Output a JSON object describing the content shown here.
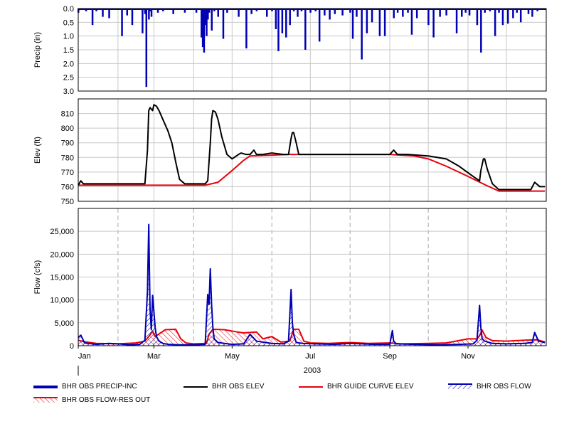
{
  "chart_data": [
    {
      "type": "bar",
      "ylabel": "Precip (in)",
      "ylim": [
        3.0,
        0.0
      ],
      "inverted": true,
      "yticks": [
        "0.0",
        "0.5",
        "1.0",
        "1.5",
        "2.0",
        "2.5",
        "3.0"
      ],
      "grid": true,
      "series": [
        {
          "name": "BHR OBS PRECIP-INC",
          "color": "#0000b4",
          "x": [
            "2003-01-01",
            "2003-01-03",
            "2003-01-07",
            "2003-01-12",
            "2003-01-15",
            "2003-01-20",
            "2003-01-25",
            "2003-01-31",
            "2003-02-04",
            "2003-02-08",
            "2003-02-12",
            "2003-02-16",
            "2003-02-20",
            "2003-02-22",
            "2003-02-23",
            "2003-02-25",
            "2003-02-26",
            "2003-02-27",
            "2003-03-01",
            "2003-03-04",
            "2003-03-08",
            "2003-03-12",
            "2003-03-16",
            "2003-03-20",
            "2003-03-25",
            "2003-03-30",
            "2003-04-03",
            "2003-04-07",
            "2003-04-08",
            "2003-04-09",
            "2003-04-10",
            "2003-04-11",
            "2003-04-12",
            "2003-04-13",
            "2003-04-15",
            "2003-04-17",
            "2003-04-20",
            "2003-04-24",
            "2003-04-27",
            "2003-05-02",
            "2003-05-06",
            "2003-05-09",
            "2003-05-12",
            "2003-05-16",
            "2003-05-20",
            "2003-05-25",
            "2003-05-28",
            "2003-06-01",
            "2003-06-04",
            "2003-06-06",
            "2003-06-09",
            "2003-06-12",
            "2003-06-15",
            "2003-06-18",
            "2003-06-21",
            "2003-06-24",
            "2003-06-27",
            "2003-07-01",
            "2003-07-05",
            "2003-07-08",
            "2003-07-10",
            "2003-07-12",
            "2003-07-16",
            "2003-07-20",
            "2003-07-22",
            "2003-07-26",
            "2003-07-29",
            "2003-08-01",
            "2003-08-03",
            "2003-08-06",
            "2003-08-10",
            "2003-08-14",
            "2003-08-18",
            "2003-08-20",
            "2003-08-24",
            "2003-08-28",
            "2003-09-01",
            "2003-09-04",
            "2003-09-07",
            "2003-09-11",
            "2003-09-15",
            "2003-09-18",
            "2003-09-22",
            "2003-09-27",
            "2003-10-01",
            "2003-10-05",
            "2003-10-10",
            "2003-10-15",
            "2003-10-19",
            "2003-10-23",
            "2003-10-27",
            "2003-10-30",
            "2003-11-02",
            "2003-11-05",
            "2003-11-08",
            "2003-11-11",
            "2003-11-14",
            "2003-11-18",
            "2003-11-22",
            "2003-11-25",
            "2003-11-28",
            "2003-12-02",
            "2003-12-06",
            "2003-12-09",
            "2003-12-12",
            "2003-12-15",
            "2003-12-18",
            "2003-12-21",
            "2003-12-25",
            "2003-12-29"
          ],
          "values": [
            0.15,
            0.05,
            0.1,
            0.6,
            0.1,
            0.3,
            0.35,
            0.05,
            1.0,
            0.25,
            0.6,
            0.05,
            0.9,
            0.2,
            2.85,
            0.4,
            0.1,
            0.3,
            0.05,
            0.15,
            0.1,
            0.05,
            0.2,
            0.05,
            0.15,
            0.05,
            0.15,
            1.05,
            1.4,
            1.6,
            0.6,
            1.0,
            0.4,
            0.15,
            0.8,
            0.1,
            0.3,
            1.1,
            0.15,
            0.05,
            0.3,
            0.05,
            1.45,
            0.2,
            0.1,
            0.05,
            0.3,
            0.1,
            0.75,
            1.55,
            0.9,
            1.05,
            0.6,
            0.1,
            0.3,
            0.1,
            1.5,
            0.15,
            0.1,
            1.2,
            0.05,
            0.25,
            0.4,
            0.2,
            0.05,
            0.25,
            0.05,
            0.15,
            1.1,
            0.3,
            1.85,
            0.9,
            0.5,
            0.05,
            1.0,
            1.0,
            0.05,
            0.35,
            0.15,
            0.3,
            0.15,
            0.95,
            0.35,
            0.05,
            0.6,
            1.05,
            0.3,
            0.25,
            0.05,
            0.9,
            0.3,
            0.15,
            0.25,
            0.05,
            0.6,
            1.6,
            0.15,
            0.1,
            1.0,
            0.15,
            0.6,
            0.55,
            0.35,
            0.15,
            0.5,
            0.05,
            0.2,
            0.3,
            0.1,
            0.05
          ]
        }
      ]
    },
    {
      "type": "line",
      "ylabel": "Elev (ft)",
      "ylim": [
        750,
        820
      ],
      "yticks": [
        "750",
        "760",
        "770",
        "780",
        "790",
        "800",
        "810"
      ],
      "grid": true,
      "series": [
        {
          "name": "BHR OBS ELEV",
          "color": "#000000",
          "x": [
            "2003-01-01",
            "2003-01-03",
            "2003-01-05",
            "2003-01-10",
            "2003-01-20",
            "2003-01-31",
            "2003-02-10",
            "2003-02-15",
            "2003-02-20",
            "2003-02-22",
            "2003-02-24",
            "2003-02-25",
            "2003-02-26",
            "2003-02-28",
            "2003-03-01",
            "2003-03-03",
            "2003-03-05",
            "2003-03-08",
            "2003-03-12",
            "2003-03-15",
            "2003-03-18",
            "2003-03-21",
            "2003-03-25",
            "2003-03-30",
            "2003-04-05",
            "2003-04-08",
            "2003-04-10",
            "2003-04-12",
            "2003-04-14",
            "2003-04-15",
            "2003-04-16",
            "2003-04-18",
            "2003-04-20",
            "2003-04-23",
            "2003-04-27",
            "2003-05-01",
            "2003-05-06",
            "2003-05-08",
            "2003-05-12",
            "2003-05-15",
            "2003-05-18",
            "2003-05-20",
            "2003-05-25",
            "2003-06-01",
            "2003-06-10",
            "2003-06-14",
            "2003-06-16",
            "2003-06-17",
            "2003-06-18",
            "2003-06-20",
            "2003-06-22",
            "2003-06-25",
            "2003-07-01",
            "2003-07-15",
            "2003-08-01",
            "2003-08-15",
            "2003-09-01",
            "2003-09-04",
            "2003-09-05",
            "2003-09-07",
            "2003-09-15",
            "2003-10-01",
            "2003-10-15",
            "2003-10-25",
            "2003-11-05",
            "2003-11-10",
            "2003-11-11",
            "2003-11-13",
            "2003-11-14",
            "2003-11-16",
            "2003-11-20",
            "2003-11-25",
            "2003-12-01",
            "2003-12-05",
            "2003-12-10",
            "2003-12-20",
            "2003-12-23",
            "2003-12-27",
            "2003-12-31"
          ],
          "values": [
            761,
            764,
            762,
            762,
            762,
            762,
            762,
            762,
            762,
            762,
            785,
            812,
            814,
            812,
            816,
            815,
            812,
            806,
            798,
            790,
            777,
            765,
            762,
            762,
            762,
            762,
            762,
            764,
            790,
            806,
            812,
            811,
            806,
            794,
            782,
            779,
            782,
            783,
            782,
            782,
            785,
            782,
            782,
            783,
            782,
            782,
            793,
            797,
            797,
            790,
            782,
            782,
            782,
            782,
            782,
            782,
            782,
            785,
            784,
            782,
            782,
            781,
            779,
            774,
            767,
            764,
            771,
            779,
            779,
            772,
            762,
            758,
            758,
            758,
            758,
            758,
            763,
            760,
            760
          ]
        },
        {
          "name": "BHR GUIDE CURVE ELEV",
          "color": "#e8000b",
          "x": [
            "2003-01-01",
            "2003-04-10",
            "2003-04-20",
            "2003-05-01",
            "2003-05-10",
            "2003-05-15",
            "2003-06-15",
            "2003-09-01",
            "2003-09-20",
            "2003-10-01",
            "2003-10-15",
            "2003-11-01",
            "2003-11-15",
            "2003-11-25",
            "2003-12-31"
          ],
          "values": [
            761,
            761,
            763,
            771,
            778,
            781,
            782,
            782,
            781,
            779,
            774,
            767,
            761,
            757,
            757
          ]
        }
      ]
    },
    {
      "type": "area",
      "ylabel": "Flow (cfs)",
      "xlabel": "2003",
      "ylim": [
        0,
        30000
      ],
      "yticks": [
        "0",
        "5,000",
        "10,000",
        "15,000",
        "20,000",
        "25,000"
      ],
      "xticks": [
        "Jan",
        "Mar",
        "May",
        "Jul",
        "Sep",
        "Nov"
      ],
      "grid": true,
      "series": [
        {
          "name": "BHR OBS FLOW",
          "color": "#0000b4",
          "x": [
            "2003-01-01",
            "2003-01-03",
            "2003-01-06",
            "2003-01-15",
            "2003-01-25",
            "2003-02-01",
            "2003-02-10",
            "2003-02-18",
            "2003-02-22",
            "2003-02-24",
            "2003-02-25",
            "2003-02-26",
            "2003-02-27",
            "2003-02-28",
            "2003-03-02",
            "2003-03-03",
            "2003-03-05",
            "2003-03-08",
            "2003-03-12",
            "2003-03-20",
            "2003-04-01",
            "2003-04-10",
            "2003-04-12",
            "2003-04-13",
            "2003-04-14",
            "2003-04-15",
            "2003-04-16",
            "2003-04-17",
            "2003-04-20",
            "2003-04-25",
            "2003-05-01",
            "2003-05-10",
            "2003-05-15",
            "2003-05-20",
            "2003-06-01",
            "2003-06-10",
            "2003-06-14",
            "2003-06-16",
            "2003-06-17",
            "2003-06-18",
            "2003-06-20",
            "2003-06-25",
            "2003-07-05",
            "2003-07-20",
            "2003-08-01",
            "2003-08-20",
            "2003-09-01",
            "2003-09-03",
            "2003-09-04",
            "2003-09-06",
            "2003-09-20",
            "2003-10-10",
            "2003-10-25",
            "2003-11-05",
            "2003-11-08",
            "2003-11-10",
            "2003-11-11",
            "2003-11-12",
            "2003-11-14",
            "2003-11-20",
            "2003-12-01",
            "2003-12-15",
            "2003-12-21",
            "2003-12-23",
            "2003-12-26",
            "2003-12-31"
          ],
          "values": [
            1800,
            2300,
            600,
            300,
            500,
            400,
            200,
            300,
            1200,
            12000,
            26500,
            8000,
            3500,
            11000,
            4000,
            2000,
            1000,
            500,
            300,
            200,
            200,
            300,
            11200,
            9000,
            16800,
            9000,
            4000,
            1500,
            700,
            500,
            300,
            400,
            2500,
            1000,
            500,
            400,
            1000,
            12300,
            5000,
            2500,
            700,
            500,
            400,
            300,
            500,
            300,
            300,
            3300,
            1000,
            400,
            300,
            200,
            300,
            400,
            1200,
            8800,
            4000,
            1500,
            1000,
            500,
            400,
            500,
            700,
            2900,
            1000,
            700
          ]
        },
        {
          "name": "BHR OBS FLOW-RES OUT",
          "color": "#e8000b",
          "x": [
            "2003-01-01",
            "2003-01-05",
            "2003-01-15",
            "2003-02-01",
            "2003-02-15",
            "2003-02-22",
            "2003-02-25",
            "2003-02-28",
            "2003-03-02",
            "2003-03-10",
            "2003-03-18",
            "2003-03-22",
            "2003-03-26",
            "2003-04-01",
            "2003-04-11",
            "2003-04-13",
            "2003-04-16",
            "2003-04-25",
            "2003-05-05",
            "2003-05-10",
            "2003-05-20",
            "2003-05-25",
            "2003-06-01",
            "2003-06-08",
            "2003-06-15",
            "2003-06-18",
            "2003-06-22",
            "2003-06-26",
            "2003-07-01",
            "2003-07-15",
            "2003-08-01",
            "2003-08-15",
            "2003-09-01",
            "2003-09-10",
            "2003-10-01",
            "2003-10-15",
            "2003-11-01",
            "2003-11-08",
            "2003-11-10",
            "2003-11-12",
            "2003-11-15",
            "2003-11-20",
            "2003-12-01",
            "2003-12-15",
            "2003-12-25",
            "2003-12-31"
          ],
          "values": [
            1200,
            900,
            500,
            400,
            600,
            1000,
            2000,
            3200,
            2000,
            3500,
            3600,
            1500,
            600,
            400,
            500,
            2500,
            3600,
            3500,
            3000,
            2800,
            3000,
            1500,
            2000,
            800,
            1000,
            3600,
            3600,
            1000,
            600,
            500,
            700,
            500,
            600,
            400,
            500,
            600,
            1500,
            1500,
            2200,
            3400,
            1800,
            1100,
            1000,
            1200,
            1300,
            800
          ]
        }
      ]
    }
  ],
  "x_date_range": [
    "2003-01-01",
    "2004-01-01"
  ],
  "x_tick_dates": [
    "2003-01-01",
    "2003-03-01",
    "2003-05-01",
    "2003-07-01",
    "2003-09-01",
    "2003-11-01"
  ],
  "legend": [
    {
      "label": "BHR OBS PRECIP-INC",
      "kind": "thick-line",
      "color": "#0000b4"
    },
    {
      "label": "BHR OBS ELEV",
      "kind": "line",
      "color": "#000000"
    },
    {
      "label": "BHR GUIDE CURVE ELEV",
      "kind": "line",
      "color": "#e8000b"
    },
    {
      "label": "BHR OBS FLOW",
      "kind": "hatch",
      "color": "#0000b4"
    },
    {
      "label": "BHR OBS FLOW-RES OUT",
      "kind": "hatch",
      "color": "#e8000b"
    }
  ]
}
